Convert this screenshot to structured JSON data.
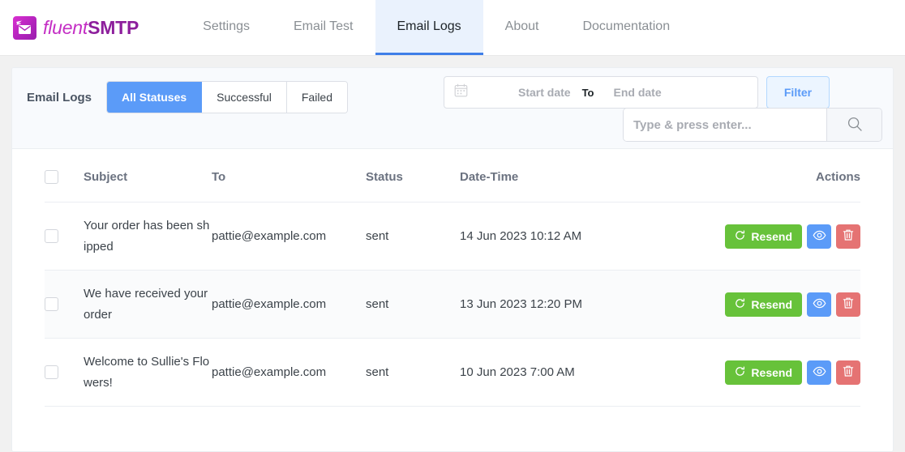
{
  "brand": {
    "icon": "envelope-logo-icon",
    "name_light": "fluent",
    "name_bold": "SMTP"
  },
  "nav": {
    "items": [
      {
        "label": "Settings",
        "active": false
      },
      {
        "label": "Email Test",
        "active": false
      },
      {
        "label": "Email Logs",
        "active": true
      },
      {
        "label": "About",
        "active": false
      },
      {
        "label": "Documentation",
        "active": false
      }
    ]
  },
  "filters": {
    "title": "Email Logs",
    "statuses": [
      {
        "label": "All Statuses",
        "active": true
      },
      {
        "label": "Successful",
        "active": false
      },
      {
        "label": "Failed",
        "active": false
      }
    ],
    "date_range": {
      "icon": "calendar-icon",
      "start_placeholder": "Start date",
      "separator": "To",
      "end_placeholder": "End date",
      "start_value": "",
      "end_value": ""
    },
    "filter_button": "Filter",
    "search": {
      "placeholder": "Type & press enter...",
      "value": "",
      "icon": "search-icon"
    }
  },
  "table": {
    "columns": [
      "",
      "Subject",
      "To",
      "Status",
      "Date-Time",
      "",
      "Actions"
    ],
    "rows": [
      {
        "subject": "Your order has been shipped",
        "to": "pattie@example.com",
        "status": "sent",
        "datetime": "14 Jun 2023 10:12 AM",
        "resend_label": "Resend"
      },
      {
        "subject": "We have received your order",
        "to": "pattie@example.com",
        "status": "sent",
        "datetime": "13 Jun 2023 12:20 PM",
        "resend_label": "Resend"
      },
      {
        "subject": "Welcome to Sullie's Flowers!",
        "to": "pattie@example.com",
        "status": "sent",
        "datetime": "10 Jun 2023 7:00 AM",
        "resend_label": "Resend"
      }
    ]
  },
  "colors": {
    "accent_blue": "#5b9bf8",
    "brand_purple": "#b324bd",
    "success_green": "#67c23a",
    "danger_red": "#e57373",
    "active_tab_bg": "#eaf2fd"
  }
}
